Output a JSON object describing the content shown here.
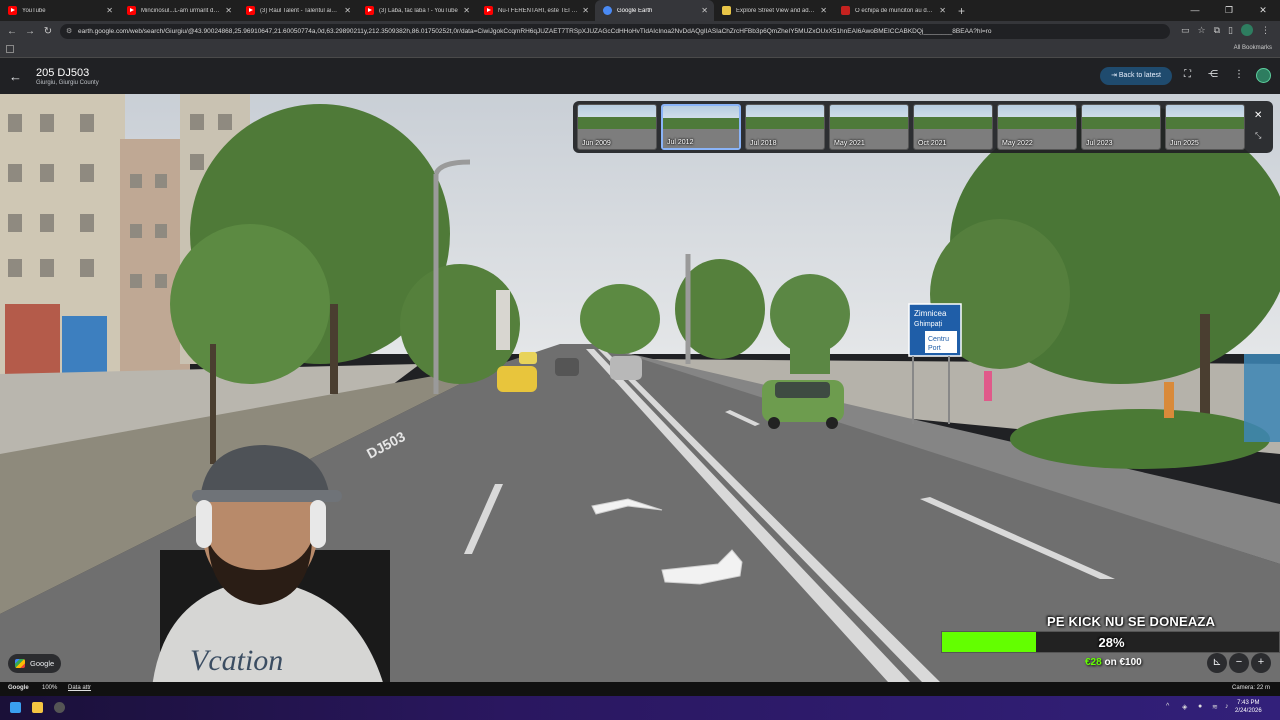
{
  "browser": {
    "tabs": [
      {
        "label": "YouTube",
        "icon": "youtube-icon",
        "active": false
      },
      {
        "label": "Mincinosul...L-am urmărit două",
        "icon": "youtube-icon",
        "active": false
      },
      {
        "label": "(3) Raul Talent - Talentul aia fin",
        "icon": "youtube-icon",
        "active": false
      },
      {
        "label": "(3) Laba, fac laba ! - YouTube",
        "icon": "youtube-icon",
        "active": false
      },
      {
        "label": "Nu-l FERENTARI, este TEI TOBO",
        "icon": "youtube-icon",
        "active": false
      },
      {
        "label": "Google Earth",
        "icon": "google-earth-icon",
        "active": true
      },
      {
        "label": "Explore Street View and add yo",
        "icon": "street-view-icon",
        "active": false
      },
      {
        "label": "O echipă de muncitori au dădă",
        "icon": "gmail-icon",
        "active": false
      }
    ],
    "url": "earth.google.com/web/search/Giurgiu/@43.90024868,25.96910647,21.60050774a,0d,63.29890211y,212.3509382h,86.01750252t,0r/data=CiwiJgokCcqmRH6qJUZAET7TRSpXJUZAGcCdHHoHvTldAIcInoa2NvDdAQgIIASIaChZrcHFBb3p6QmZheIY5MUZxOUxX51hnEAI6AwoBMEICCABKDQj________8BEAA?hl=ro",
    "all_bookmarks_label": "All Bookmarks"
  },
  "earth": {
    "title": "205 DJ503",
    "subtitle": "Giurgiu, Giurgiu County",
    "back_to_latest": "Back to latest",
    "timeline": [
      {
        "label": "Jun 2009",
        "active": false
      },
      {
        "label": "Jul 2012",
        "active": true
      },
      {
        "label": "Jul 2018",
        "active": false
      },
      {
        "label": "May 2021",
        "active": false
      },
      {
        "label": "Oct 2021",
        "active": false
      },
      {
        "label": "May 2022",
        "active": false
      },
      {
        "label": "Jul 2023",
        "active": false
      },
      {
        "label": "Jun 2025",
        "active": false
      }
    ],
    "scene_signs": {
      "road_marking": "DJ503",
      "sign_line1": "Zimnicea",
      "sign_line2": "Ghimpați",
      "sign_line3": "Centru",
      "sign_line4": "Port"
    },
    "google_chip": "Google",
    "status": {
      "logo": "Google",
      "zoom": "100%",
      "data_attr": "Data attr",
      "camera": "Camera: 22 m"
    }
  },
  "overlay": {
    "donation_title": "PE KICK NU SE DONEAZA",
    "donation_percent_label": "28%",
    "donation_fraction": 0.28,
    "donation_raised": "€28",
    "donation_sep": "on",
    "donation_goal": "€100"
  },
  "taskbar": {
    "time": "7:43 PM",
    "date": "2/24/2026"
  },
  "colors": {
    "accent_blue": "#8ab4f8",
    "back_to_latest_bg": "#1f4b6e",
    "donation_green": "#63ff00",
    "taskbar_purple": "#2a1760"
  }
}
